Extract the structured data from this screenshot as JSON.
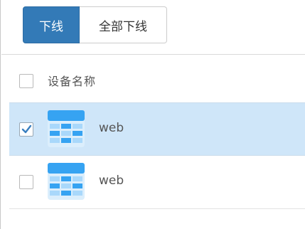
{
  "toolbar": {
    "offline_label": "下线",
    "offline_all_label": "全部下线"
  },
  "table": {
    "header": {
      "column_label": "设备名称",
      "checked": false
    },
    "rows": [
      {
        "name": "web",
        "checked": true,
        "icon": "table-grid-icon"
      },
      {
        "name": "web",
        "checked": false,
        "icon": "table-grid-icon"
      }
    ]
  },
  "colors": {
    "primary": "#337ab7",
    "selected_row": "#cfe6f9",
    "icon_blue": "#36a3f2",
    "icon_light": "#a9d8fb"
  }
}
